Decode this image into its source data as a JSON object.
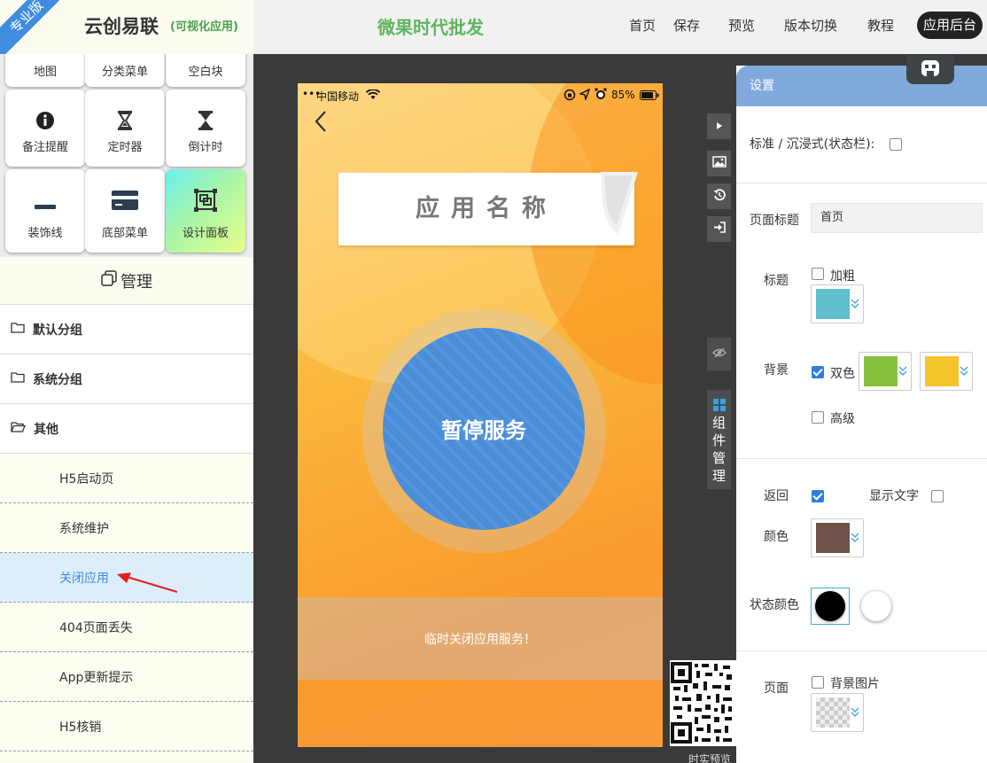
{
  "header": {
    "ribbon": "专业版",
    "brand": "云创易联",
    "brand_sub": "(可视化应用)",
    "app_title": "微果时代批发",
    "nav": {
      "home": "首页",
      "save": "保存",
      "preview": "预览",
      "version": "版本切换",
      "tutorial": "教程",
      "admin": "应用后台"
    }
  },
  "components": {
    "row0": [
      "地图",
      "分类菜单",
      "空白块"
    ],
    "row1": [
      "备注提醒",
      "定时器",
      "倒计时"
    ],
    "row2": [
      "装饰线",
      "底部菜单",
      "设计面板"
    ]
  },
  "manage": {
    "title": "管理",
    "groups": [
      "默认分组",
      "系统分组",
      "其他"
    ],
    "pages": [
      "H5启动页",
      "系统维护",
      "关闭应用",
      "404页面丢失",
      "App更新提示",
      "H5核销"
    ]
  },
  "phone": {
    "carrier": "中国移动",
    "battery": "85%",
    "app_name": "应用名称",
    "circle_text": "暂停服务",
    "notice": "临时关闭应用服务！"
  },
  "tools": {
    "component_manager": [
      "组",
      "件",
      "管",
      "理"
    ],
    "qr_label": "时实预览"
  },
  "settings": {
    "title": "设置",
    "status_bar_label": "标准 / 沉浸式(状态栏):",
    "page_title_label": "页面标题",
    "page_title_value": "首页",
    "title_label": "标题",
    "bold_label": "加粗",
    "title_color": "#5fbfcb",
    "background_label": "背景",
    "dual_color_label": "双色",
    "bg_color_1": "#88c03d",
    "bg_color_2": "#f5c42a",
    "advanced_label": "高级",
    "back_label": "返回",
    "show_text_label": "显示文字",
    "color_label": "颜色",
    "back_color": "#6e5149",
    "status_color_label": "状态颜色",
    "page_label": "页面",
    "bg_image_label": "背景图片"
  }
}
